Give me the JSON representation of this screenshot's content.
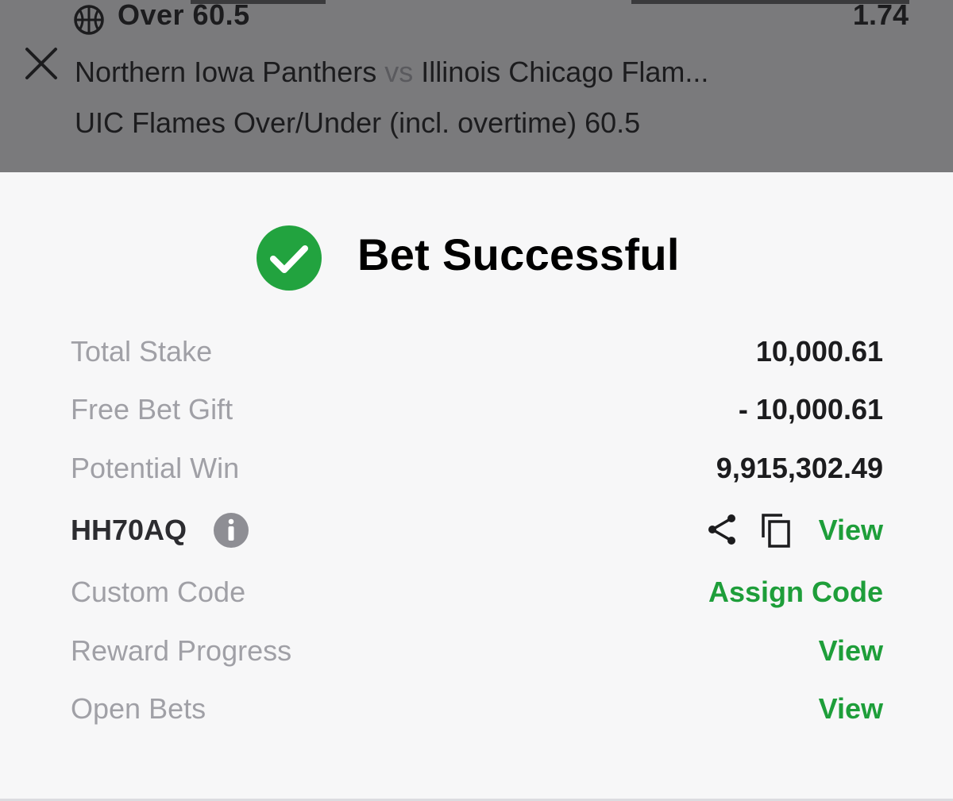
{
  "header": {
    "selection": "Over 60.5",
    "odds": "1.74",
    "home_team": "Northern Iowa Panthers",
    "vs": "vs",
    "away_team": "Illinois Chicago Flam...",
    "market": "UIC Flames Over/Under (incl. overtime) 60.5",
    "sport_icon": "basketball-icon",
    "close_icon": "close-icon"
  },
  "result": {
    "title": "Bet Successful",
    "status_icon": "checkmark-circle-icon",
    "accent_color": "#1e9e3a"
  },
  "details": {
    "total_stake_label": "Total Stake",
    "total_stake_value": "10,000.61",
    "free_bet_label": "Free Bet Gift",
    "free_bet_value": "- 10,000.61",
    "potential_win_label": "Potential Win",
    "potential_win_value": "9,915,302.49",
    "booking_code": "HH70AQ",
    "view_label": "View",
    "custom_code_label": "Custom Code",
    "assign_code_label": "Assign Code",
    "reward_progress_label": "Reward Progress",
    "reward_view_label": "View",
    "open_bets_label": "Open Bets",
    "open_bets_view_label": "View"
  }
}
